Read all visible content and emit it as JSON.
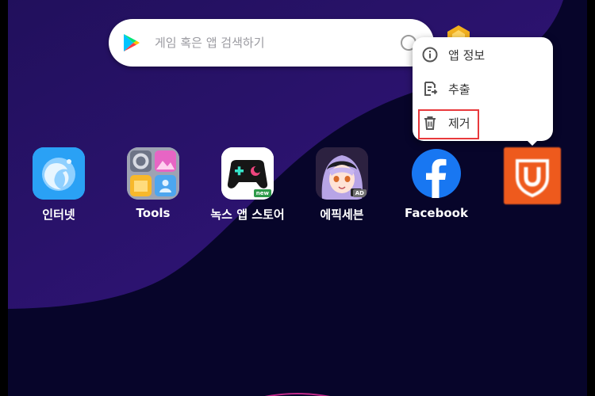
{
  "search": {
    "placeholder": "게임 혹은 앱 검색하기"
  },
  "context_menu": {
    "items": [
      {
        "label": "앱 정보",
        "icon": "info-icon"
      },
      {
        "label": "추출",
        "icon": "extract-icon"
      },
      {
        "label": "제거",
        "icon": "trash-icon",
        "highlighted": true
      }
    ]
  },
  "apps": [
    {
      "label": "인터넷",
      "icon": "browser-icon"
    },
    {
      "label": "Tools",
      "icon": "tools-icon"
    },
    {
      "label": "녹스 앱 스토어",
      "icon": "gamepad-icon",
      "badge": "new"
    },
    {
      "label": "에픽세븐",
      "icon": "anime-character-icon",
      "badge": "AD"
    },
    {
      "label": "Facebook",
      "icon": "facebook-icon"
    },
    {
      "label": "",
      "icon": "vpn-shield-icon",
      "dragging": true
    }
  ],
  "colors": {
    "background_dark": "#07052a",
    "wallpaper_purple": "#2a1170",
    "highlight_red": "#e8393c",
    "facebook_blue": "#1877f2"
  }
}
